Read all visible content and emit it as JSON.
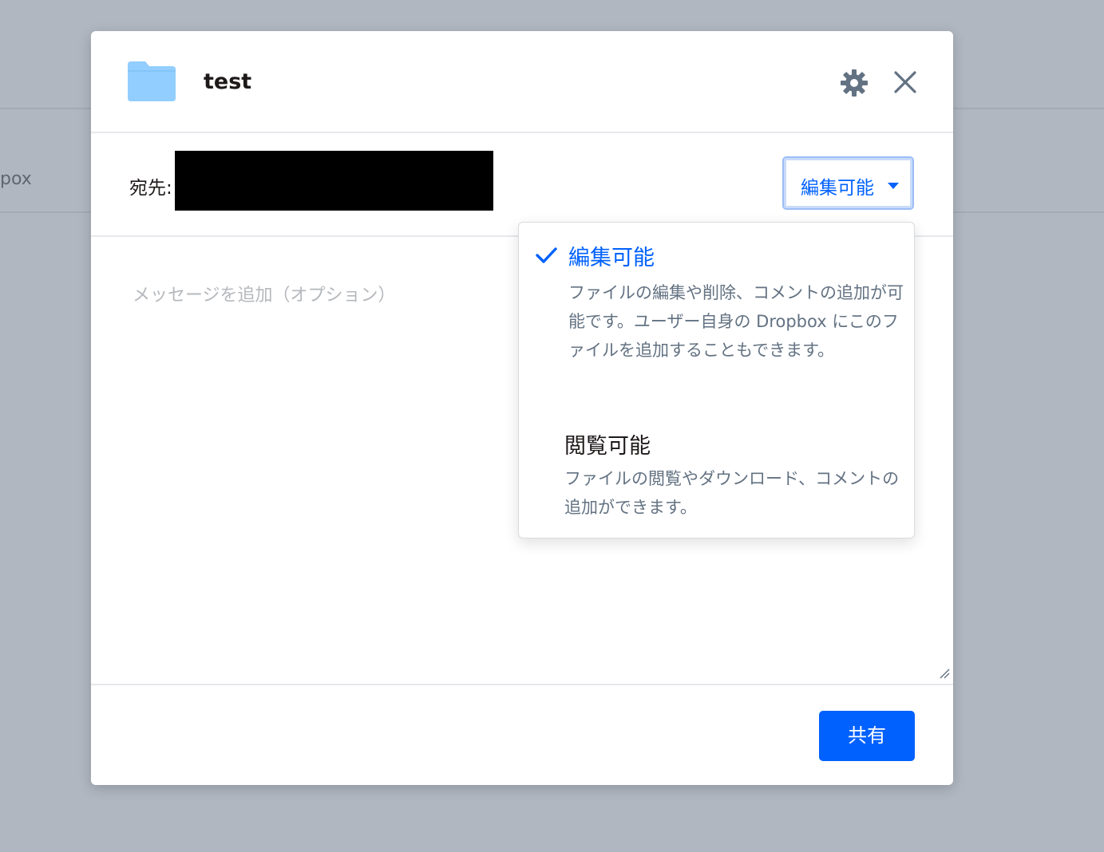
{
  "background": {
    "partial_text": "pox"
  },
  "dialog": {
    "title": "test",
    "to_label": "宛先:",
    "permission_selected": "編集可能",
    "message_placeholder": "メッセージを追加（オプション）",
    "share_label": "共有"
  },
  "dropdown": {
    "options": [
      {
        "title": "編集可能",
        "description": "ファイルの編集や削除、コメントの追加が可能です。ユーザー自身の Dropbox にこのファイルを追加することもできます。",
        "selected": true
      },
      {
        "title": "閲覧可能",
        "description": "ファイルの閲覧やダウンロード、コメントの追加ができます。",
        "selected": false
      }
    ]
  },
  "colors": {
    "accent": "#0061fe",
    "folder": "#92ceff",
    "overlay": "#b0b7c1",
    "muted_text": "#637282"
  },
  "icons": [
    "folder-icon",
    "gear-icon",
    "close-icon",
    "chevron-down-icon",
    "check-icon",
    "resize-handle-icon"
  ]
}
